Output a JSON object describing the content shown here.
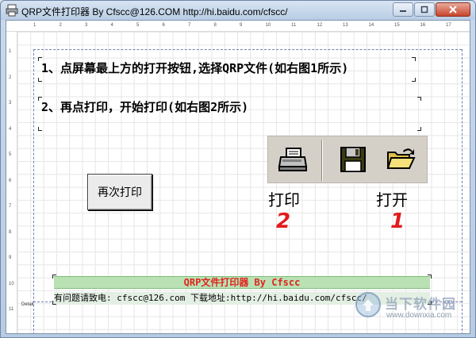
{
  "window": {
    "title": "QRP文件打印器 By Cfscc@126.COM  http://hi.baidu.com/cfscc/"
  },
  "ruler": {
    "top_numbers": [
      "1",
      "2",
      "3",
      "4",
      "5",
      "6",
      "7",
      "8",
      "9",
      "10",
      "11",
      "12",
      "13",
      "14",
      "15",
      "16",
      "17"
    ],
    "left_numbers": [
      "1",
      "2",
      "3",
      "4",
      "5",
      "6",
      "7",
      "8",
      "9",
      "10",
      "11"
    ]
  },
  "instructions": {
    "step1": "1、点屏幕最上方的打开按钮,选择QRP文件(如右图1所示)",
    "step2": "2、再点打印，开始打印(如右图2所示)"
  },
  "print_again_button": "再次打印",
  "toolbar_demo": {
    "print_label": "打印",
    "open_label": "打开",
    "print_number": "2",
    "open_number": "1"
  },
  "footer": {
    "title": "QRP文件打印器 By Cfscc",
    "contact_info": "有问题请致电: cfscc@126.com   下载地址:http://hi.baidu.com/cfscc/",
    "detail_label": "Detail"
  },
  "watermark": {
    "name": "当下软件园",
    "url": "www.downxia.com"
  },
  "colors": {
    "footer_title": "#e0231c",
    "footer_band": "#b9e1b4",
    "handwritten_numbers": "#e21b1b"
  }
}
